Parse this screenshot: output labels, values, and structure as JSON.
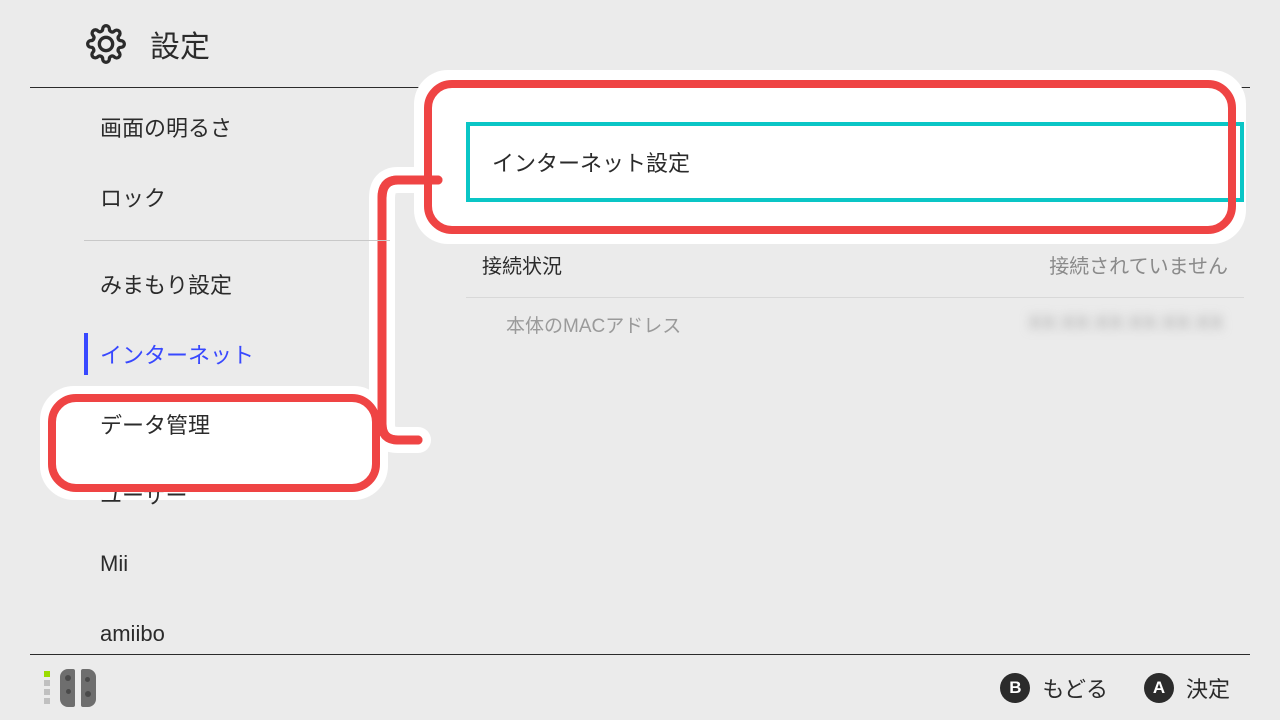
{
  "header": {
    "title": "設定"
  },
  "sidebar": {
    "items": [
      {
        "label": "画面の明るさ"
      },
      {
        "label": "ロック"
      },
      {
        "label": "みまもり設定"
      },
      {
        "label": "インターネット"
      },
      {
        "label": "データ管理"
      },
      {
        "label": "ユーザー"
      },
      {
        "label": "Mii"
      },
      {
        "label": "amiibo"
      }
    ],
    "selected_index": 3
  },
  "content": {
    "internet_settings_label": "インターネット設定",
    "connection_status_label": "接続状況",
    "connection_status_value": "接続されていません",
    "mac_label": "本体のMACアドレス",
    "mac_value": "XX:XX:XX:XX:XX:XX"
  },
  "footer": {
    "back": {
      "glyph": "B",
      "label": "もどる"
    },
    "ok": {
      "glyph": "A",
      "label": "決定"
    }
  },
  "annotation": {
    "highlight_color": "#ef4444",
    "focus_color": "#0ac6c6"
  }
}
